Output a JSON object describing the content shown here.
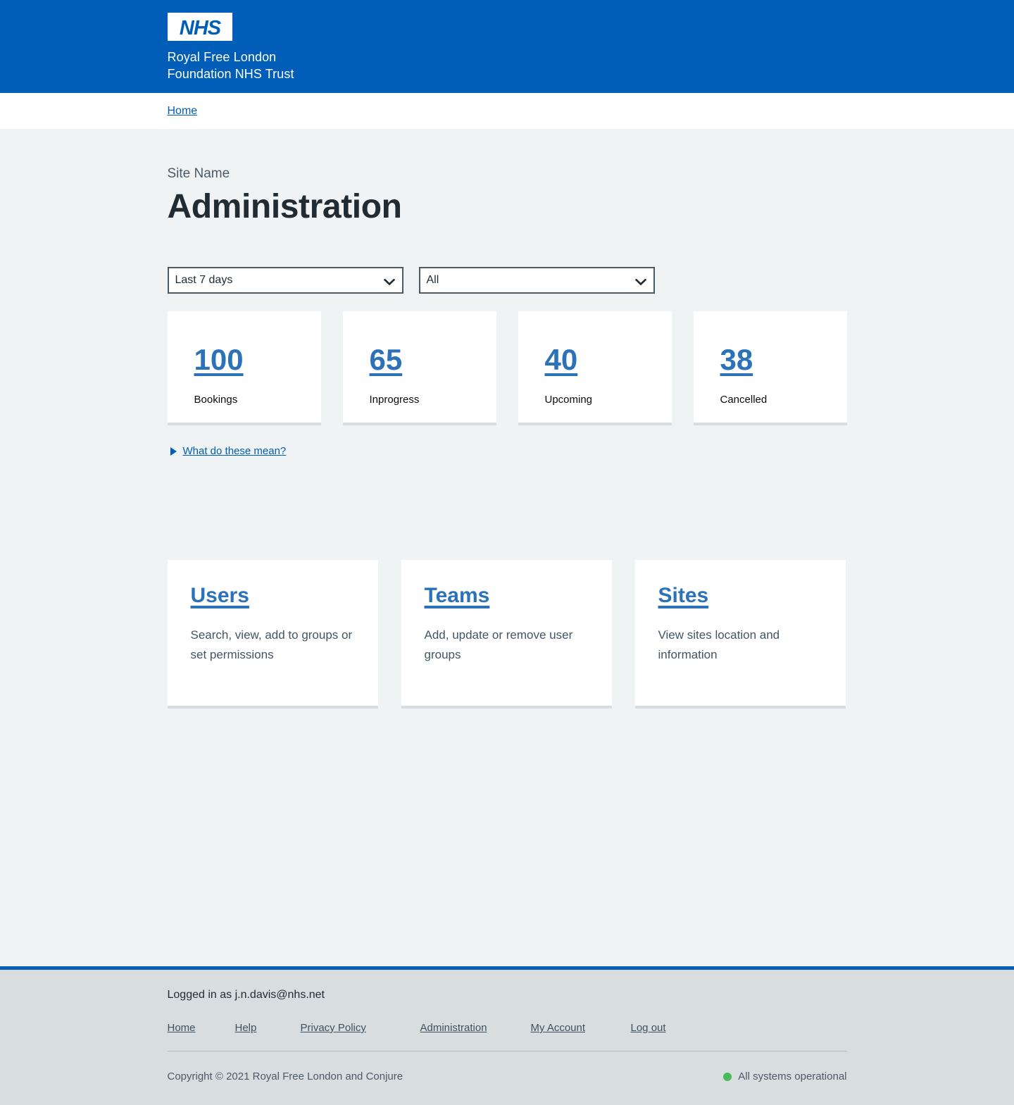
{
  "header": {
    "logo_text": "NHS",
    "org_line1": "Royal Free London",
    "org_line2": "Foundation NHS Trust",
    "bg_color": "#005eb8"
  },
  "breadcrumb": {
    "home_label": "Home"
  },
  "page": {
    "caption": "Site Name",
    "title": "Administration"
  },
  "filters": {
    "period": {
      "selected": "Last 7 days",
      "icon": "chevron-down-icon"
    },
    "scope": {
      "selected": "All",
      "icon": "chevron-down-icon"
    }
  },
  "stats": [
    {
      "value": "100",
      "label": "Bookings"
    },
    {
      "value": "65",
      "label": "Inprogress"
    },
    {
      "value": "40",
      "label": "Upcoming"
    },
    {
      "value": "38",
      "label": "Cancelled"
    }
  ],
  "details": {
    "marker_icon": "triangle-right-icon",
    "summary": "What do these mean?"
  },
  "nav_cards": [
    {
      "title": "Users",
      "desc": "Search, view, add to groups or set permissions"
    },
    {
      "title": "Teams",
      "desc": "Add, update or remove user groups"
    },
    {
      "title": "Sites",
      "desc": "View sites location and information"
    }
  ],
  "footer": {
    "logged_in": "Logged in as j.n.davis@nhs.net",
    "links": [
      "Home",
      "Help",
      "Privacy Policy",
      "Administration",
      "My Account",
      "Log out"
    ],
    "copyright": "Copyright © 2021 Royal Free London and Conjure",
    "status_text": "All systems operational",
    "status_color": "#48bb5b"
  },
  "colors": {
    "nhs_blue": "#005eb8",
    "link_blue": "#2b72b8",
    "page_bg": "#eff3f4",
    "footer_bg": "#d8dde0"
  }
}
